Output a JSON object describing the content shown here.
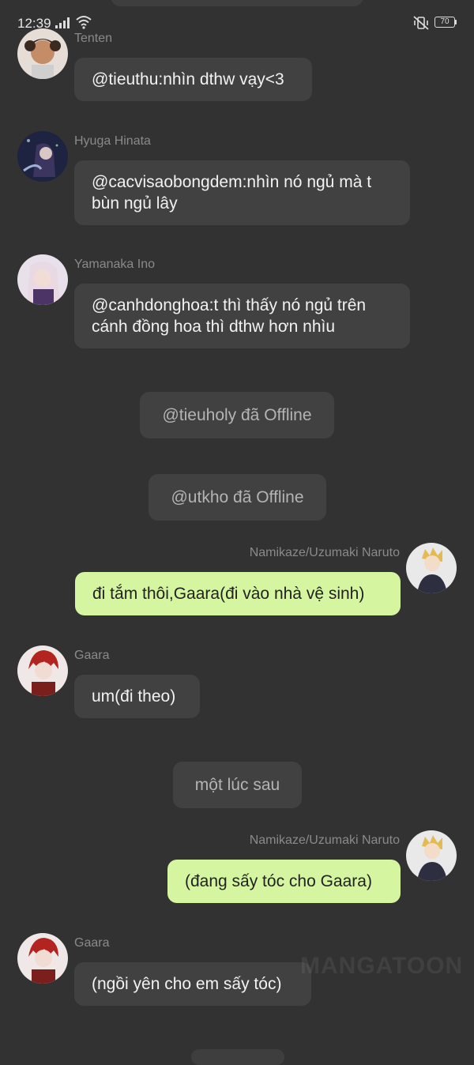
{
  "status_bar": {
    "time": "12:39",
    "battery": "70"
  },
  "watermark": "MANGATOON",
  "messages": [
    {
      "sender": "Tenten",
      "text": "@tieuthu:nhìn dthw vạy<3"
    },
    {
      "sender": "Hyuga Hinata",
      "text": "@cacvisaobongdem:nhìn nó ngủ mà t bùn ngủ lây"
    },
    {
      "sender": "Yamanaka Ino",
      "text": "@canhdonghoa:t thì thấy nó ngủ trên cánh đồng hoa thì dthw hơn nhìu"
    },
    {
      "system": "@tieuholy đã Offline"
    },
    {
      "system": "@utkho đã Offline"
    },
    {
      "sender": "Namikaze/Uzumaki Naruto",
      "text": "đi tắm thôi,Gaara(đi vào nhà vệ sinh)"
    },
    {
      "sender": "Gaara",
      "text": "um(đi theo)"
    },
    {
      "system": "một lúc sau"
    },
    {
      "sender": "Namikaze/Uzumaki Naruto",
      "text": "(đang sấy tóc cho Gaara)"
    },
    {
      "sender": "Gaara",
      "text": "(ngồi yên cho em sấy tóc)"
    }
  ]
}
